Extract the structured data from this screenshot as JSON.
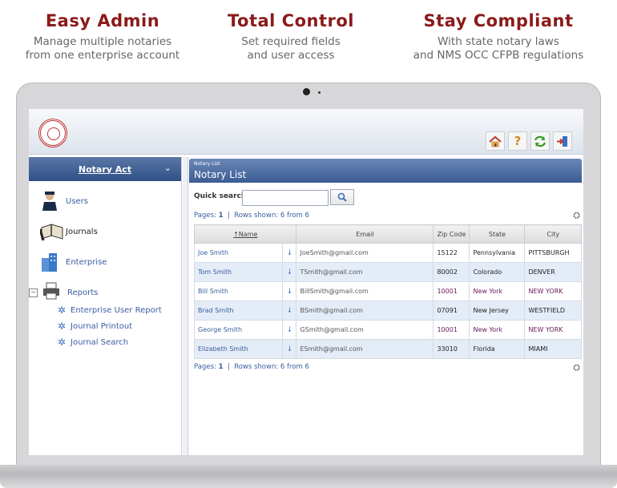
{
  "features": [
    {
      "title": "Easy Admin",
      "line1": "Manage multiple notaries",
      "line2": "from one enterprise account"
    },
    {
      "title": "Total Control",
      "line1": "Set required fields",
      "line2": "and user access"
    },
    {
      "title": "Stay Compliant",
      "line1": "With state notary laws",
      "line2": "and NMS OCC CFPB regulations"
    }
  ],
  "toolbar": {
    "icons": [
      "home-icon",
      "help-icon",
      "refresh-icon",
      "logout-icon"
    ],
    "help_glyph": "?"
  },
  "sidebar": {
    "header": "Notary Act",
    "items": [
      {
        "label": "Users",
        "icon": "user-icon"
      },
      {
        "label": "Journals",
        "icon": "journal-icon"
      },
      {
        "label": "Enterprise",
        "icon": "enterprise-icon"
      },
      {
        "label": "Reports",
        "icon": "printer-icon"
      }
    ],
    "subitems": [
      "Enterprise User Report",
      "Journal Printout",
      "Journal Search"
    ]
  },
  "main": {
    "breadcrumb": "Notary List",
    "title": "Notary List",
    "quick_search_label": "Quick search",
    "quick_search_value": "",
    "pager": {
      "pages_label": "Pages:",
      "page": "1",
      "separator": "|",
      "rows_shown": "Rows shown: 6 from 6"
    },
    "columns": [
      "↑Name",
      "Email",
      "Zip Code",
      "State",
      "City"
    ],
    "rows": [
      {
        "name": "Joe Smith",
        "email": "JoeSmith@gmail.com",
        "zip": "15122",
        "state": "Pennsylvania",
        "city": "PITTSBURGH",
        "highlight": false
      },
      {
        "name": "Tom Smith",
        "email": "TSmith@gmail.com",
        "zip": "80002",
        "state": "Colorado",
        "city": "DENVER",
        "highlight": false
      },
      {
        "name": "Bill Smith",
        "email": "BillSmith@gmail.com",
        "zip": "10001",
        "state": "New York",
        "city": "NEW YORK",
        "highlight": true
      },
      {
        "name": "Brad Smith",
        "email": "BSmith@gmail.com",
        "zip": "07091",
        "state": "New Jersey",
        "city": "WESTFIELD",
        "highlight": false
      },
      {
        "name": "George Smith",
        "email": "GSmith@gmail.com",
        "zip": "10001",
        "state": "New York",
        "city": "NEW YORK",
        "highlight": true
      },
      {
        "name": "Elizabeth Smith",
        "email": "ESmith@gmail.com",
        "zip": "33010",
        "state": "Florida",
        "city": "MIAMI",
        "highlight": false
      }
    ]
  },
  "colors": {
    "title_red": "#8b1a1a",
    "header_blue": "#2f4f86",
    "link_blue": "#3a5ea0",
    "row_alt": "#e4ecf7"
  }
}
